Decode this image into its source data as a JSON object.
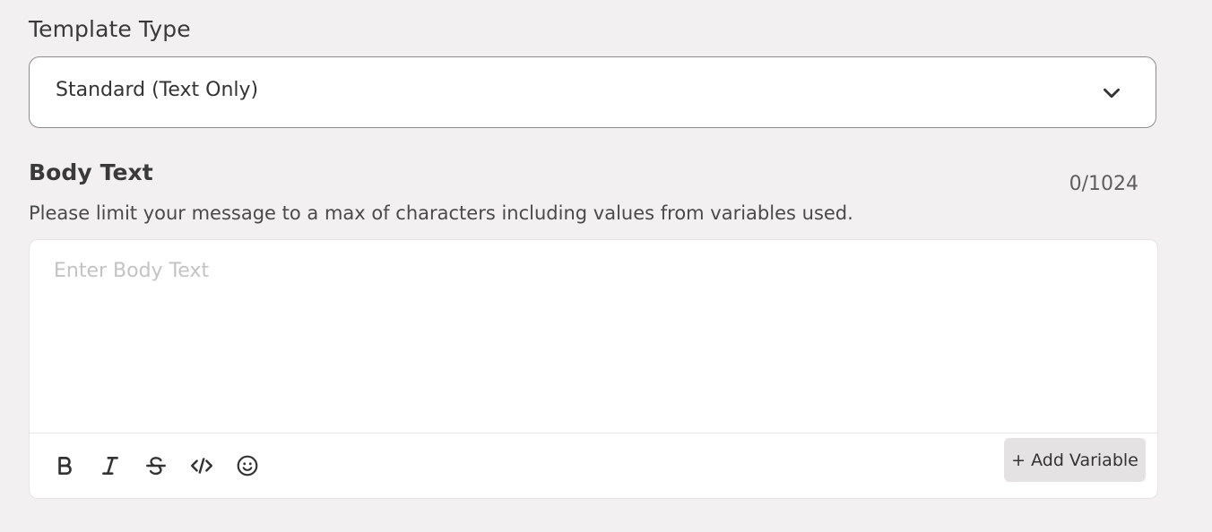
{
  "template_type": {
    "label": "Template Type",
    "selected": "Standard (Text Only)",
    "icon": "chevron-down-icon"
  },
  "body_text": {
    "label": "Body Text",
    "counter": "0/1024",
    "hint": "Please limit your message to a max of characters including values from variables used.",
    "placeholder": "Enter Body Text",
    "value": ""
  },
  "toolbar": {
    "tools": [
      {
        "name": "bold-icon"
      },
      {
        "name": "italic-icon"
      },
      {
        "name": "strikethrough-icon"
      },
      {
        "name": "code-icon"
      },
      {
        "name": "emoji-icon"
      }
    ],
    "add_variable_label": "+ Add Variable"
  }
}
